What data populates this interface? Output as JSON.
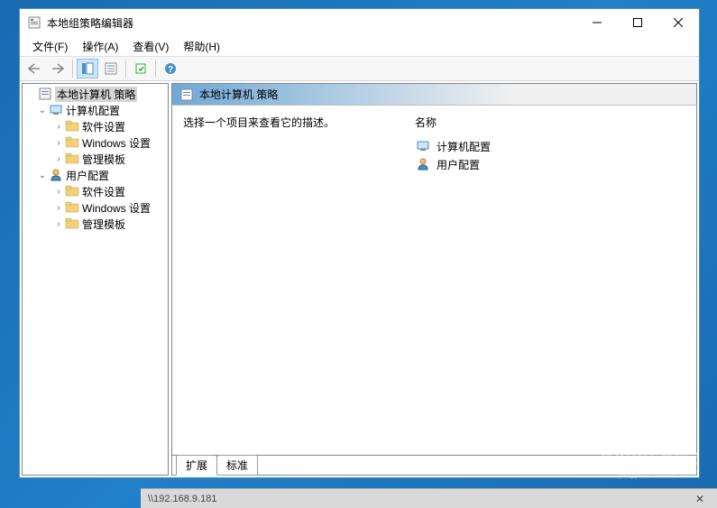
{
  "window": {
    "title": "本地组策略编辑器"
  },
  "menu": {
    "file": "文件(F)",
    "action": "操作(A)",
    "view": "查看(V)",
    "help": "帮助(H)"
  },
  "tree": {
    "root": "本地计算机 策略",
    "computer_config": "计算机配置",
    "software_settings": "软件设置",
    "windows_settings": "Windows 设置",
    "admin_templates": "管理模板",
    "user_config": "用户配置"
  },
  "main": {
    "header": "本地计算机 策略",
    "description": "选择一个项目来查看它的描述。",
    "name_col": "名称",
    "items": {
      "computer": "计算机配置",
      "user": "用户配置"
    },
    "tabs": {
      "extended": "扩展",
      "standard": "标准"
    }
  },
  "taskbar": {
    "path": "\\\\192.168.9.181"
  },
  "watermark": {
    "brand": "Baidu 经验",
    "url": "jingyan.baidu.com"
  }
}
